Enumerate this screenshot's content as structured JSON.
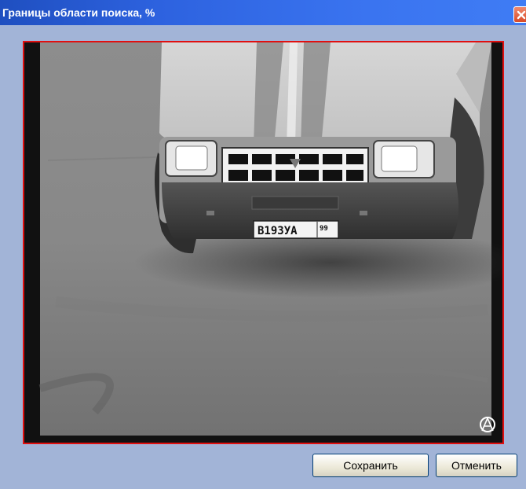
{
  "window": {
    "title": "Границы области поиска, %"
  },
  "video": {
    "plate_main": "В193УА",
    "plate_region": "99"
  },
  "buttons": {
    "save_label": "Сохранить",
    "cancel_label": "Отменить"
  },
  "colors": {
    "title_bar": "#2d62df",
    "dialog_background": "#a2b4d7",
    "region_border": "#e01010"
  },
  "icons": {
    "close": "close-icon",
    "camera_overlay": "camera-logo-icon"
  }
}
